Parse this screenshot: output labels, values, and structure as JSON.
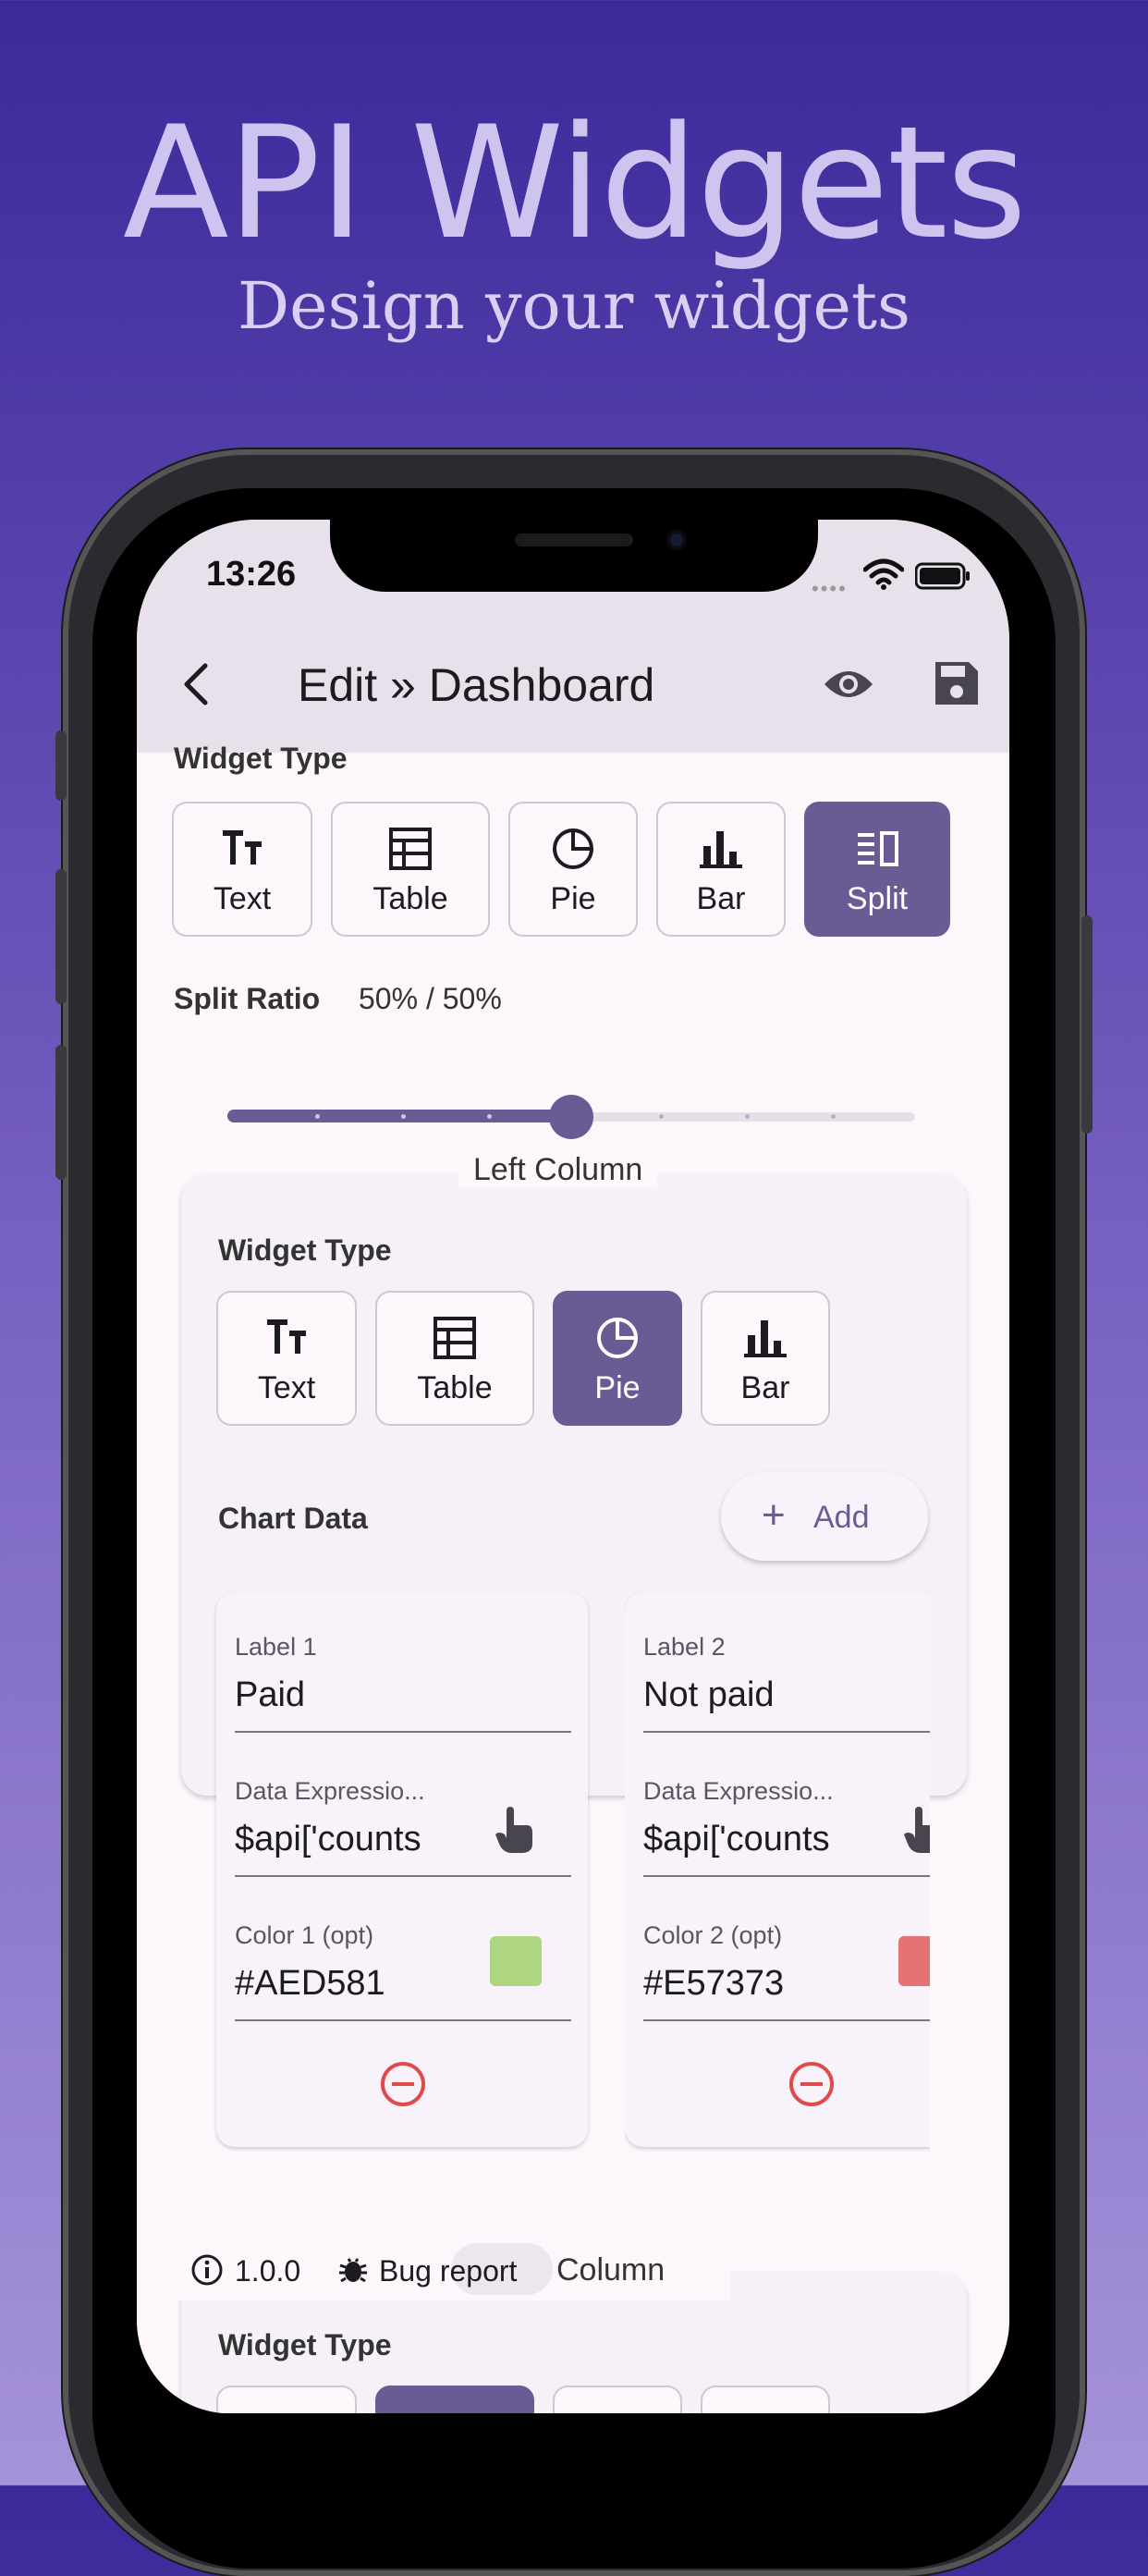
{
  "hero": {
    "title": "API Widgets",
    "subtitle": "Design your widgets"
  },
  "status_bar": {
    "time": "13:26"
  },
  "app_bar": {
    "title": "Edit » Dashboard"
  },
  "widget_type": {
    "label": "Widget Type",
    "options": [
      "Text",
      "Table",
      "Pie",
      "Bar",
      "Split"
    ],
    "selected": "Split"
  },
  "split_ratio": {
    "label": "Split Ratio",
    "value_text": "50% / 50%",
    "value": 0.5
  },
  "left_column": {
    "legend": "Left Column",
    "widget_type_label": "Widget Type",
    "options": [
      "Text",
      "Table",
      "Pie",
      "Bar"
    ],
    "selected": "Pie",
    "chart_data_label": "Chart Data",
    "add_label": "Add",
    "entries": [
      {
        "label_title": "Label 1",
        "label_value": "Paid",
        "expr_title": "Data Expressio...",
        "expr_value": "$api['counts",
        "color_title": "Color 1 (opt)",
        "color_value": "#AED581",
        "color": "#AED581"
      },
      {
        "label_title": "Label 2",
        "label_value": "Not paid",
        "expr_title": "Data Expressio...",
        "expr_value": "$api['counts",
        "color_title": "Color 2 (opt)",
        "color_value": "#E57373",
        "color": "#E57373"
      }
    ]
  },
  "footer": {
    "version": "1.0.0",
    "bug_report": "Bug report",
    "column_text": "Column"
  },
  "right_column": {
    "widget_type_label": "Widget Type"
  },
  "colors": {
    "accent": "#6b5b95",
    "appbar": "#e8e1ec",
    "remove_red": "#e04a4a"
  }
}
